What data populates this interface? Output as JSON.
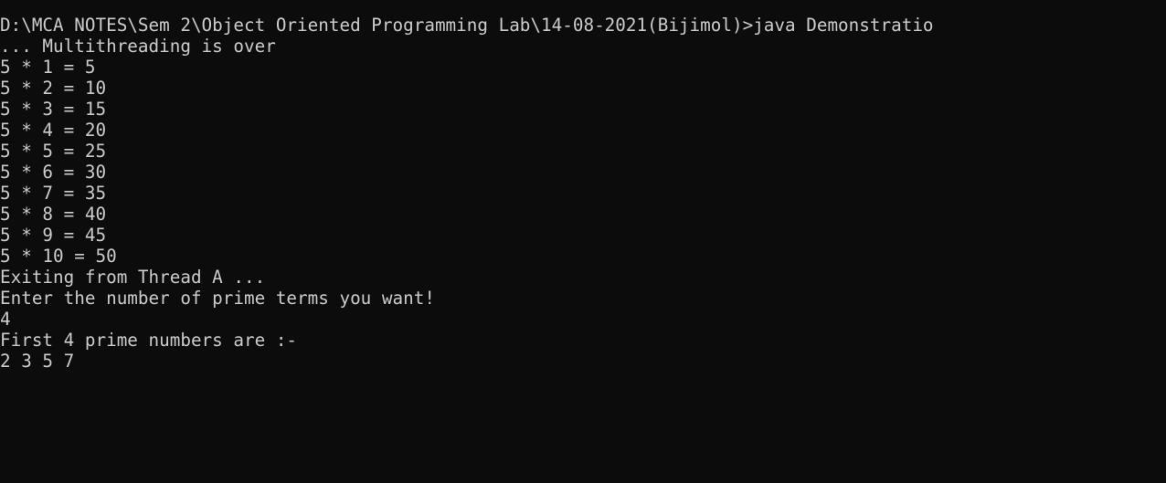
{
  "console": {
    "lines": [
      "D:\\MCA NOTES\\Sem 2\\Object Oriented Programming Lab\\14-08-2021(Bijimol)>java Demonstratio",
      "... Multithreading is over",
      "5 * 1 = 5",
      "5 * 2 = 10",
      "5 * 3 = 15",
      "5 * 4 = 20",
      "5 * 5 = 25",
      "5 * 6 = 30",
      "5 * 7 = 35",
      "5 * 8 = 40",
      "5 * 9 = 45",
      "5 * 10 = 50",
      "Exiting from Thread A ...",
      "Enter the number of prime terms you want!",
      "4",
      "First 4 prime numbers are :-",
      "2 3 5 7"
    ]
  },
  "colors": {
    "background": "#0c0c0c",
    "foreground": "#cccccc"
  }
}
